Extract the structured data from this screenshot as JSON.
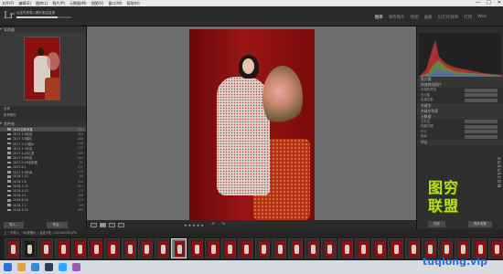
{
  "menubar": {
    "items": [
      "文件(F)",
      "编辑(E)",
      "图库(L)",
      "照片(P)",
      "元数据(M)",
      "视图(V)",
      "窗口(W)",
      "帮助(H)"
    ],
    "window_controls": [
      "—",
      "□",
      "✕"
    ]
  },
  "topbar": {
    "logo": "Lr",
    "import_message": "从文件夹导入照片到主目录",
    "import_progress": 0.75,
    "modules": [
      "图库",
      "修改照片",
      "地图",
      "画册",
      "幻灯片放映",
      "打印",
      "Web"
    ],
    "active_module": "图库"
  },
  "left_panel": {
    "navigator_title": "导航器",
    "navigator_zoom": [
      "适合",
      "填满",
      "1:1",
      "3:1"
    ],
    "catalog_lines": [
      "目录",
      "所有照片"
    ],
    "folders_title": "文件夹",
    "folders": [
      {
        "name": "2019立秋写真",
        "count": "280"
      },
      {
        "name": "2017.3.6情侣",
        "count": "318"
      },
      {
        "name": "2017.3.8婚礼",
        "count": "266"
      },
      {
        "name": "2017.3.12婚纱",
        "count": "148"
      },
      {
        "name": "2017.4.3写真",
        "count": "342"
      },
      {
        "name": "2017.4.20儿童",
        "count": "189"
      },
      {
        "name": "2017.5.6写真",
        "count": "205"
      },
      {
        "name": "2017.5.16全家福",
        "count": "97"
      },
      {
        "name": "2017.6.1",
        "count": "132"
      },
      {
        "name": "2017.7.8写真",
        "count": "176"
      },
      {
        "name": "2018.1.12",
        "count": "88"
      },
      {
        "name": "2018.2.8",
        "count": "154"
      },
      {
        "name": "2018.3.22",
        "count": "211"
      },
      {
        "name": "2018.4.15",
        "count": "73"
      },
      {
        "name": "2018.5.1",
        "count": "260"
      },
      {
        "name": "2018.6.18",
        "count": "119"
      },
      {
        "name": "2018.7.7",
        "count": "94"
      },
      {
        "name": "2018.9.10",
        "count": "187"
      }
    ],
    "selected_folder_index": 0,
    "import_button": "导入...",
    "export_button": "导出..."
  },
  "center": {
    "stars": "★★★★★",
    "rotate_left": "↶",
    "rotate_right": "↷"
  },
  "right_panel": {
    "sections": {
      "histogram": "直方图",
      "quick_develop": "快速修改照片",
      "keywords": "关键字",
      "keyword_list": "关键字列表",
      "metadata": "元数据",
      "comments": "评论"
    },
    "quick_develop_rows": [
      "存储的预设",
      "白平衡",
      "色调控制"
    ],
    "metadata_rows": [
      "文件名",
      "拍摄日期",
      "尺寸",
      "相机"
    ],
    "sync_button": "同步",
    "sync_settings_button": "同步设置"
  },
  "filmbar": {
    "text": "上一次导入 · 50张照片 / 选定1张 / 20740030.JPG"
  },
  "filmstrip": {
    "thumb_count": 30,
    "selected_index": 10
  },
  "watermark": {
    "line1": "图穷",
    "line2": "联盟",
    "vertical": "XURUSCOM",
    "site": "tuqiong.vip"
  }
}
